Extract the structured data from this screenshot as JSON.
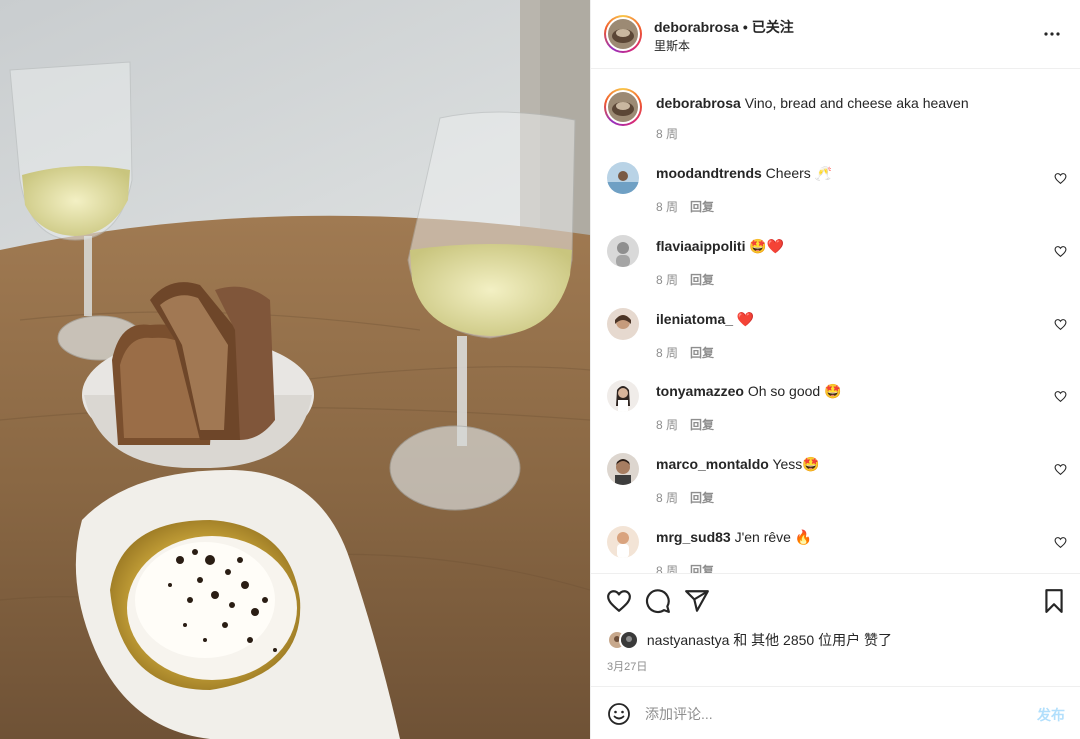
{
  "post": {
    "username": "deborabrosa",
    "separator": "•",
    "follow_status": "已关注",
    "location": "里斯本"
  },
  "caption": {
    "username": "deborabrosa",
    "text": "Vino, bread and cheese aka heaven",
    "time": "8 周"
  },
  "reply_label": "回复",
  "comments": [
    {
      "username": "moodandtrends",
      "text": "Cheers 🥂",
      "time": "8 周"
    },
    {
      "username": "flaviaaippoliti",
      "text": "🤩❤️",
      "time": "8 周"
    },
    {
      "username": "ileniatoma_",
      "text": "❤️",
      "time": "8 周"
    },
    {
      "username": "tonyamazzeo",
      "text": "Oh so good 🤩",
      "time": "8 周"
    },
    {
      "username": "marco_montaldo",
      "text": "Yess🤩",
      "time": "8 周"
    },
    {
      "username": "mrg_sud83",
      "text": "J'en rêve 🔥",
      "time": "8 周"
    }
  ],
  "likes": {
    "text": "nastyanastya 和 其他 2850 位用户 赞了"
  },
  "date": "3月27日",
  "add_comment": {
    "placeholder": "添加评论...",
    "post_label": "发布"
  },
  "icons": {
    "more": "more-icon",
    "like": "heart-icon",
    "comment": "comment-icon",
    "share": "paper-plane-icon",
    "save": "bookmark-icon",
    "emoji": "smiley-icon"
  },
  "colors": {
    "post_button": "#b2dffc",
    "muted_text": "#8e8e8e",
    "divider": "#efefef"
  }
}
